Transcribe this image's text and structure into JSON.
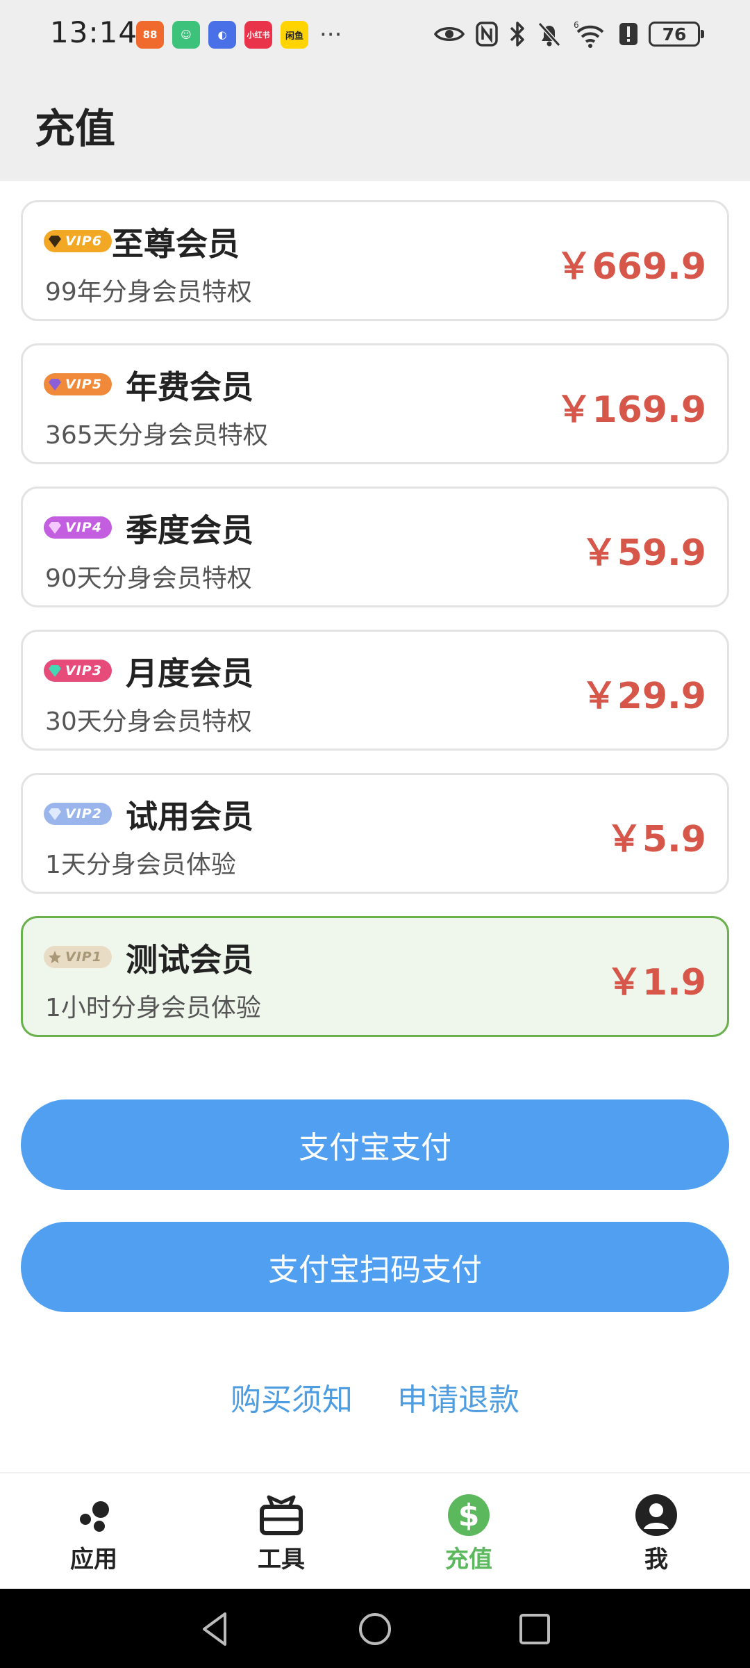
{
  "status_bar": {
    "time": "13:14",
    "apps": [
      {
        "icon": "app-orange-icon",
        "color": "#f06a2d",
        "text": "88"
      },
      {
        "icon": "app-green-icon",
        "color": "#3cc27a",
        "text": "☺"
      },
      {
        "icon": "app-blue-icon",
        "color": "#4a70e8",
        "text": "◐"
      },
      {
        "icon": "xiaohongshu-icon",
        "color": "#e8334a",
        "text": "小红书"
      },
      {
        "icon": "xianyu-icon",
        "color": "#ffd400",
        "text": "闲鱼"
      }
    ],
    "more": "···",
    "battery": "76"
  },
  "header": {
    "title": "充值"
  },
  "plans": [
    {
      "badge": "VIP6",
      "badge_color": "#f2a825",
      "name": "至尊会员",
      "desc": "99年分身会员特权",
      "price": "￥669.9",
      "selected": false
    },
    {
      "badge": "VIP5",
      "badge_color": "#f08a3a",
      "name": "年费会员",
      "desc": "365天分身会员特权",
      "price": "￥169.9",
      "selected": false
    },
    {
      "badge": "VIP4",
      "badge_color": "#c45ee0",
      "name": "季度会员",
      "desc": "90天分身会员特权",
      "price": "￥59.9",
      "selected": false
    },
    {
      "badge": "VIP3",
      "badge_color": "#e64b7a",
      "name": "月度会员",
      "desc": "30天分身会员特权",
      "price": "￥29.9",
      "selected": false
    },
    {
      "badge": "VIP2",
      "badge_color": "#9ab4ec",
      "name": "试用会员",
      "desc": "1天分身会员体验",
      "price": "￥5.9",
      "selected": false
    },
    {
      "badge": "VIP1",
      "badge_color": "#e8dcc4",
      "name": "测试会员",
      "desc": "1小时分身会员体验",
      "price": "￥1.9",
      "selected": true
    }
  ],
  "buttons": {
    "alipay": "支付宝支付",
    "alipay_qr": "支付宝扫码支付"
  },
  "links": {
    "notice": "购买须知",
    "refund": "申请退款"
  },
  "nav": {
    "items": [
      {
        "label": "应用",
        "icon": "apps-icon"
      },
      {
        "label": "工具",
        "icon": "toolbox-icon"
      },
      {
        "label": "充值",
        "icon": "dollar-icon"
      },
      {
        "label": "我",
        "icon": "account-icon"
      }
    ],
    "active_color": "#5cb85c"
  },
  "colors": {
    "price": "#d6574a",
    "button": "#509ff0",
    "link": "#4e9de0",
    "selected_border": "#6ab04c"
  }
}
